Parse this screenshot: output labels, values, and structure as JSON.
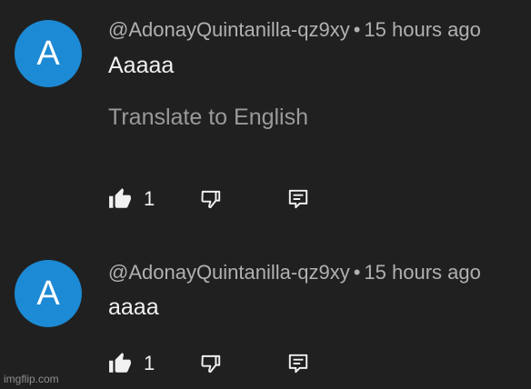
{
  "comments": [
    {
      "avatar_letter": "A",
      "author": "@AdonayQuintanilla-qz9xy",
      "separator": "•",
      "time": "15 hours ago",
      "text": "Aaaaa",
      "translate_label": "Translate to English",
      "like_count": "1"
    },
    {
      "avatar_letter": "A",
      "author": "@AdonayQuintanilla-qz9xy",
      "separator": "•",
      "time": "15 hours ago",
      "text": "aaaa",
      "like_count": "1"
    }
  ],
  "watermark": "imgflip.com",
  "icons": {
    "like": "thumbs-up-icon",
    "dislike": "thumbs-down-icon",
    "reply": "reply-icon"
  },
  "colors": {
    "background": "#202020",
    "avatar": "#1c8ad4",
    "meta_text": "#b0b0b0",
    "primary_text": "#f1f1f1",
    "secondary_text": "#9a9a9a"
  }
}
